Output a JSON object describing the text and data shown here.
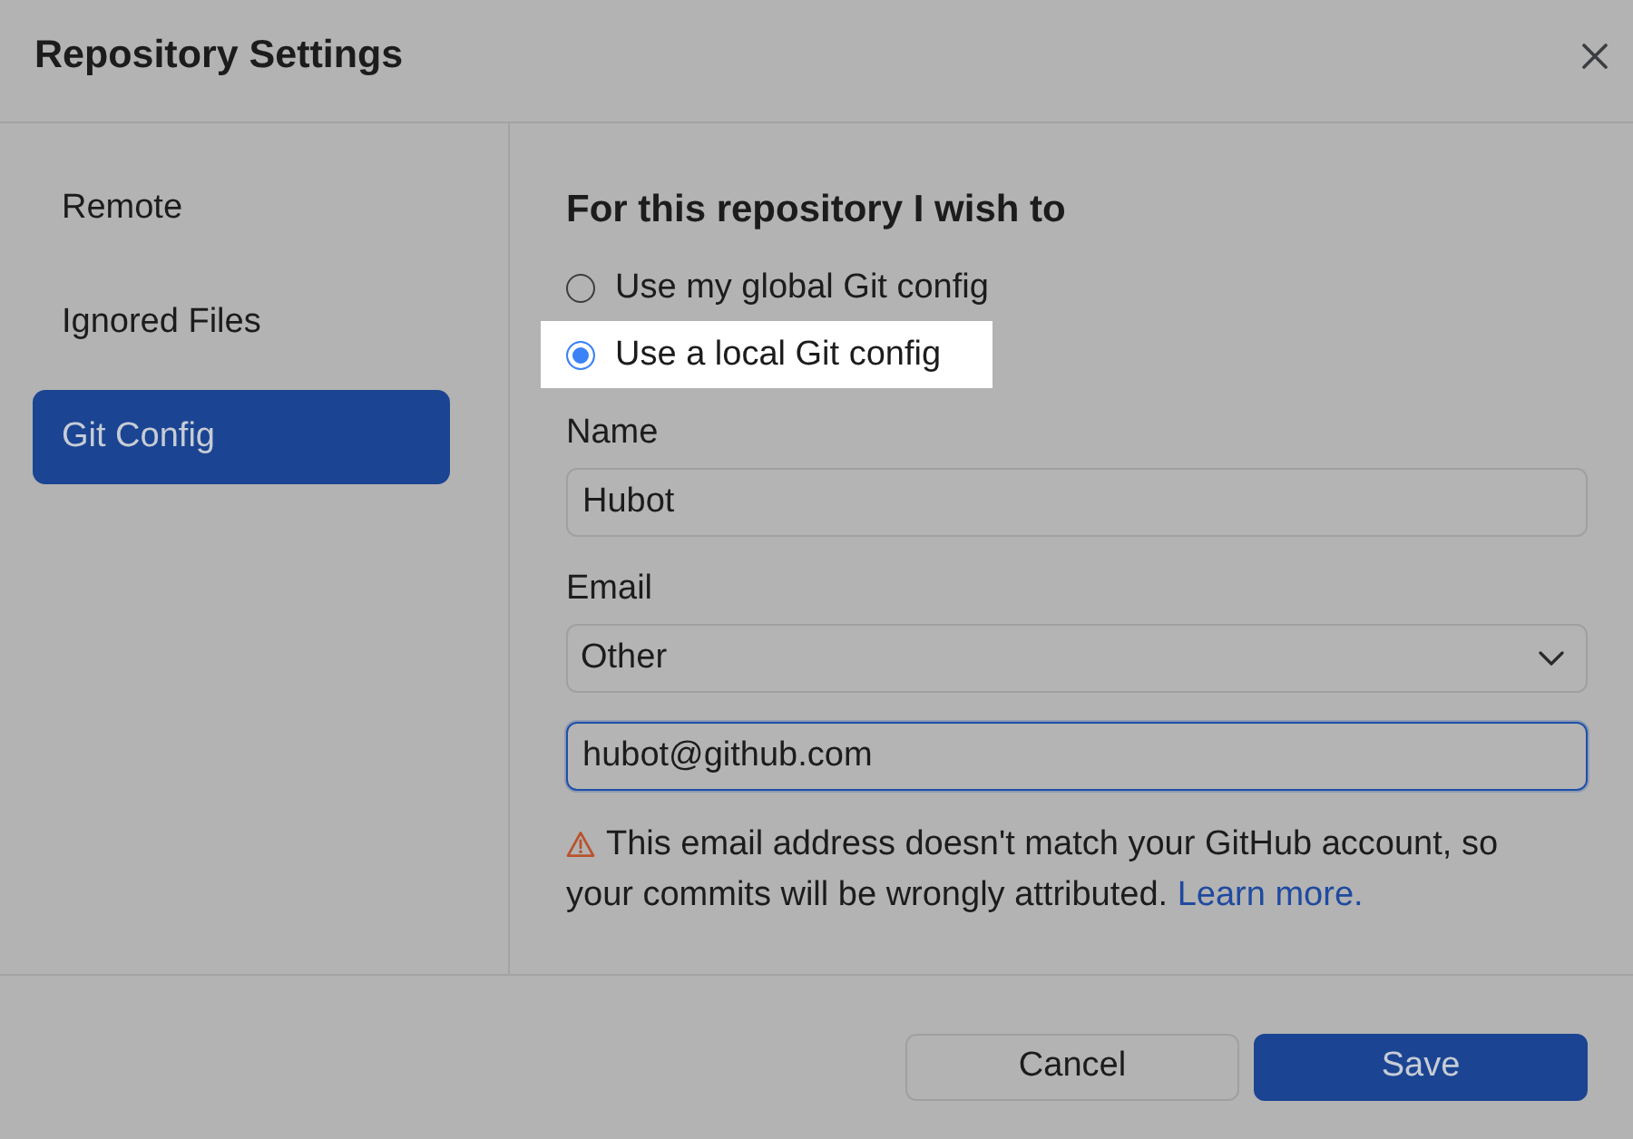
{
  "dialog": {
    "title": "Repository Settings"
  },
  "sidebar": {
    "items": [
      {
        "label": "Remote",
        "selected": false
      },
      {
        "label": "Ignored Files",
        "selected": false
      },
      {
        "label": "Git Config",
        "selected": true
      }
    ]
  },
  "content": {
    "heading": "For this repository I wish to",
    "options": [
      {
        "label": "Use my global Git config",
        "selected": false,
        "highlighted": false
      },
      {
        "label": "Use a local Git config",
        "selected": true,
        "highlighted": true
      }
    ],
    "name_field": {
      "label": "Name",
      "value": "Hubot"
    },
    "email_field": {
      "label": "Email",
      "selected_option": "Other",
      "value": "hubot@github.com",
      "focused": true
    },
    "warning": {
      "text": "This email address doesn't match your GitHub account, so your commits will be wrongly attributed.",
      "link": "Learn more."
    }
  },
  "buttons": [
    {
      "label": "Cancel",
      "kind": "secondary"
    },
    {
      "label": "Save",
      "kind": "primary"
    }
  ]
}
